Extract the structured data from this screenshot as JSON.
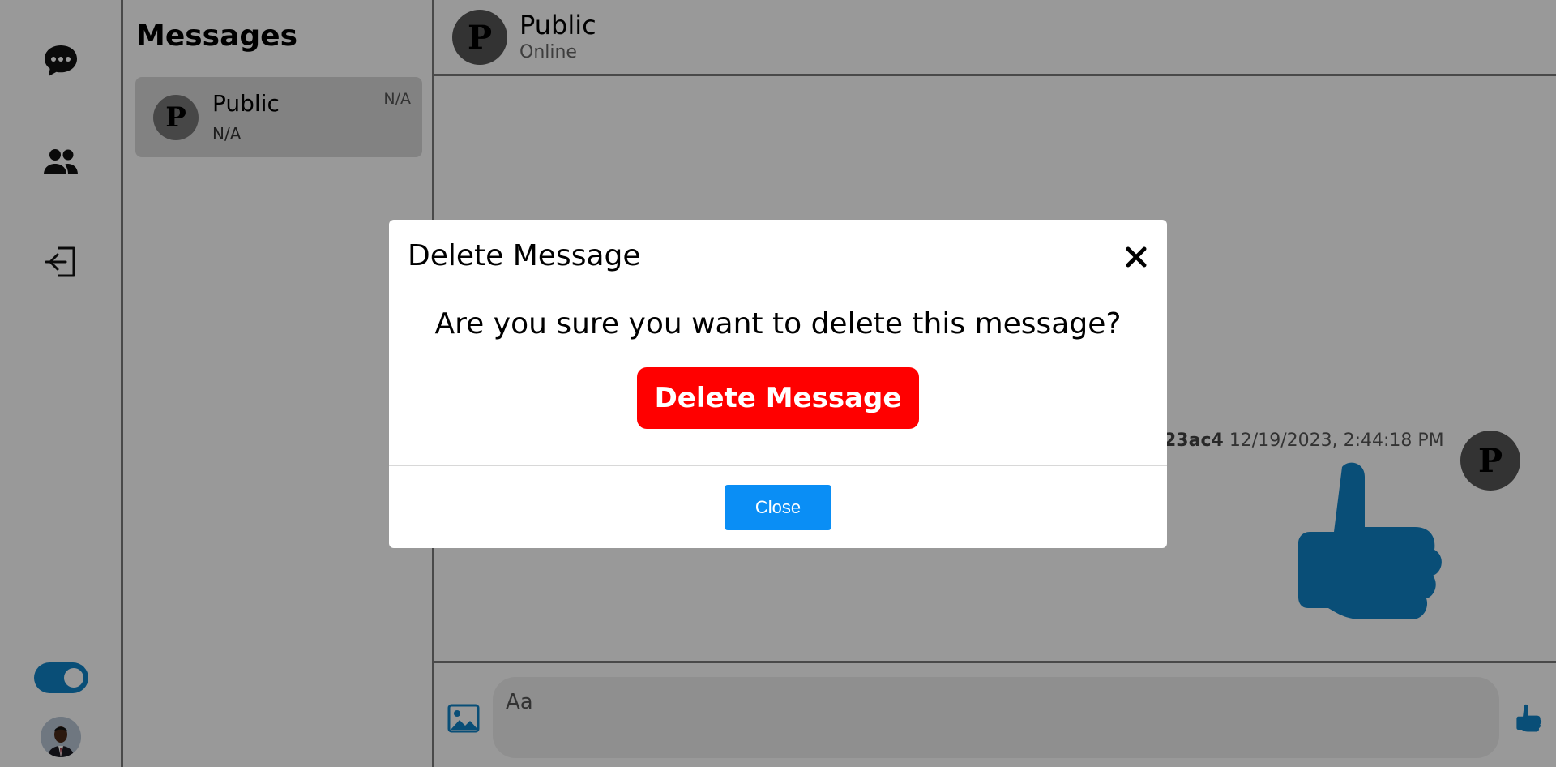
{
  "sidebar_rail": {
    "icons": [
      "chat-icon",
      "people-icon",
      "login-icon"
    ],
    "theme_toggle_on": true
  },
  "conversations": {
    "title": "Messages",
    "add_user_icon": "add-user-icon",
    "items": [
      {
        "avatar_letter": "P",
        "name": "Public",
        "preview": "N/A",
        "time": "N/A"
      }
    ]
  },
  "chat": {
    "header": {
      "avatar_letter": "P",
      "name": "Public",
      "status": "Online"
    },
    "message": {
      "sender_fragment": "23ac4",
      "timestamp": "12/19/2023, 2:44:18 PM",
      "avatar_letter": "P",
      "content_icon": "thumbs-up-icon"
    },
    "composer": {
      "placeholder": "Aa",
      "image_icon": "image-icon",
      "like_icon": "thumbs-up-icon"
    }
  },
  "modal": {
    "title": "Delete Message",
    "question": "Are you sure you want to delete this message?",
    "delete_label": "Delete Message",
    "close_label": "Close"
  },
  "colors": {
    "accent": "#0f82c7",
    "danger": "#ff0000",
    "primary_button": "#0a8ef5",
    "overlay": "rgba(0,0,0,0.4)"
  }
}
